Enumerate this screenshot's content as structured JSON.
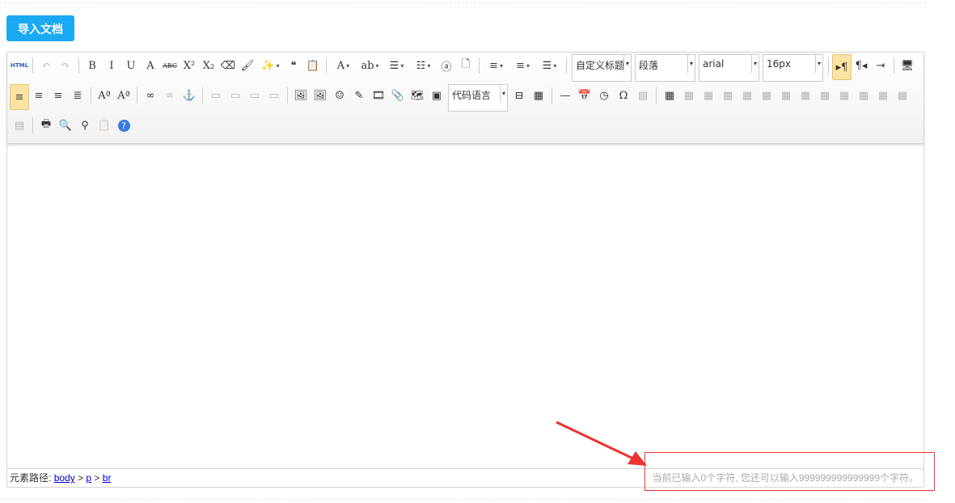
{
  "import_button": "导入文档",
  "toolbar": {
    "rows": [
      [
        {
          "n": "source-code-button",
          "g": "HTML"
        },
        {
          "s": 1
        },
        {
          "n": "undo-button",
          "g": "↶",
          "dis": 1
        },
        {
          "n": "redo-button",
          "g": "↷",
          "dis": 1
        },
        {
          "s": 1
        },
        {
          "n": "bold-button",
          "g": "B"
        },
        {
          "n": "italic-button",
          "g": "I"
        },
        {
          "n": "underline-button",
          "g": "U"
        },
        {
          "n": "font-border-button",
          "g": "A"
        },
        {
          "n": "strikethrough-button",
          "g": "ABC"
        },
        {
          "n": "superscript-button",
          "g": "X²"
        },
        {
          "n": "subscript-button",
          "g": "X₂"
        },
        {
          "n": "eraser-button",
          "g": "⌫"
        },
        {
          "n": "format-painter-button",
          "g": "🖌"
        },
        {
          "n": "auto-typeset-button",
          "g": "✨",
          "a": 1
        },
        {
          "n": "blockquote-button",
          "g": "❝"
        },
        {
          "n": "paste-plain-button",
          "g": "📋"
        },
        {
          "s": 1
        },
        {
          "n": "font-color-button",
          "g": "A",
          "a": 1
        },
        {
          "n": "back-color-button",
          "g": "ab",
          "a": 1
        },
        {
          "n": "ordered-list-button",
          "g": "☰",
          "a": 1
        },
        {
          "n": "unordered-list-button",
          "g": "☷",
          "a": 1
        },
        {
          "n": "select-all-button",
          "g": "ⓐ"
        },
        {
          "n": "clear-doc-button",
          "g": "🗋"
        },
        {
          "s": 1
        },
        {
          "n": "row-spacing-top-button",
          "g": "≡",
          "a": 1
        },
        {
          "n": "row-spacing-bottom-button",
          "g": "≡",
          "a": 1
        },
        {
          "n": "line-height-button",
          "g": "☰",
          "a": 1
        },
        {
          "s": 1
        },
        {
          "sel": "自定义标题",
          "n": "custom-style-select",
          "w": 74
        },
        {
          "sel": "段落",
          "n": "paragraph-select",
          "w": 75
        },
        {
          "sel": "arial",
          "n": "font-family-select",
          "w": 75
        },
        {
          "sel": "16px",
          "n": "font-size-select",
          "w": 75
        },
        {
          "s": 1
        },
        {
          "n": "ltr-button",
          "g": "▸¶",
          "act": 1
        },
        {
          "n": "rtl-button",
          "g": "¶◂"
        },
        {
          "n": "indent-button",
          "g": "⇥"
        },
        {
          "s": 1
        },
        {
          "n": "preview-button",
          "g": "🖥"
        }
      ],
      [
        {
          "n": "justify-left-button",
          "g": "≡",
          "act": 1
        },
        {
          "n": "justify-center-button",
          "g": "≡"
        },
        {
          "n": "justify-right-button",
          "g": "≡"
        },
        {
          "n": "justify-full-button",
          "g": "≣"
        },
        {
          "s": 1
        },
        {
          "n": "uppercase-button",
          "g": "Aª"
        },
        {
          "n": "lowercase-button",
          "g": "Aª"
        },
        {
          "s": 1
        },
        {
          "n": "link-button",
          "g": "∞"
        },
        {
          "n": "unlink-button",
          "g": "∞",
          "dis": 1
        },
        {
          "n": "anchor-button",
          "g": "⚓"
        },
        {
          "s": 1
        },
        {
          "n": "image-none-button",
          "g": "▭",
          "dis": 1
        },
        {
          "n": "image-left-button",
          "g": "▭",
          "dis": 1
        },
        {
          "n": "image-right-button",
          "g": "▭",
          "dis": 1
        },
        {
          "n": "image-center-button",
          "g": "▭",
          "dis": 1
        },
        {
          "s": 1
        },
        {
          "n": "simple-upload-button",
          "g": "🖼"
        },
        {
          "n": "insert-image-button",
          "g": "🖼"
        },
        {
          "n": "emotion-button",
          "g": "☺"
        },
        {
          "n": "scrawl-button",
          "g": "✎"
        },
        {
          "n": "insert-video-button",
          "g": "🎞"
        },
        {
          "n": "attachment-button",
          "g": "📎"
        },
        {
          "n": "map-button",
          "g": "🗺"
        },
        {
          "n": "insert-frame-button",
          "g": "▣"
        },
        {
          "sel": "代码语言",
          "n": "code-language-select",
          "w": 74
        },
        {
          "n": "page-break-button",
          "g": "⊟"
        },
        {
          "n": "template-button",
          "g": "▦"
        },
        {
          "s": 1
        },
        {
          "n": "horizontal-rule-button",
          "g": "—"
        },
        {
          "n": "date-button",
          "g": "📅"
        },
        {
          "n": "time-button",
          "g": "◷"
        },
        {
          "n": "special-chars-button",
          "g": "Ω"
        },
        {
          "n": "word-image-button",
          "g": "▨",
          "dis": 1
        },
        {
          "s": 1
        },
        {
          "n": "insert-table-button",
          "g": "▦"
        },
        {
          "n": "delete-table-button",
          "g": "▦",
          "dis": 1
        },
        {
          "n": "insert-paragraph-before-table-button",
          "g": "▦",
          "dis": 1
        },
        {
          "n": "insert-row-button",
          "g": "▦",
          "dis": 1
        },
        {
          "n": "delete-row-button",
          "g": "▦",
          "dis": 1
        },
        {
          "n": "insert-col-button",
          "g": "▦",
          "dis": 1
        },
        {
          "n": "delete-col-button",
          "g": "▦",
          "dis": 1
        },
        {
          "n": "merge-cells-button",
          "g": "▦",
          "dis": 1
        },
        {
          "n": "merge-right-button",
          "g": "▦",
          "dis": 1
        },
        {
          "n": "merge-down-button",
          "g": "▦",
          "dis": 1
        },
        {
          "n": "split-to-cells-button",
          "g": "▦",
          "dis": 1
        },
        {
          "n": "split-to-rows-button",
          "g": "▦",
          "dis": 1
        },
        {
          "n": "split-to-cols-button",
          "g": "▦",
          "dis": 1
        }
      ],
      [
        {
          "n": "charts-button",
          "g": "▤",
          "dis": 1
        },
        {
          "s": 1
        },
        {
          "n": "print-button",
          "g": "🖶"
        },
        {
          "n": "print-preview-button",
          "g": "🔍"
        },
        {
          "n": "search-replace-button",
          "g": "⚲"
        },
        {
          "n": "drafts-button",
          "g": "📋",
          "dis": 1
        },
        {
          "n": "help-button",
          "g": "?"
        }
      ]
    ]
  },
  "statusbar": {
    "path_label": "元素路径:",
    "path": [
      "body",
      "p",
      "br"
    ],
    "word_count": "当前已输入0个字符, 您还可以输入999999999999999个字符。"
  },
  "colors": {
    "button": "#1aa9f2",
    "annotation": "#e33333"
  }
}
